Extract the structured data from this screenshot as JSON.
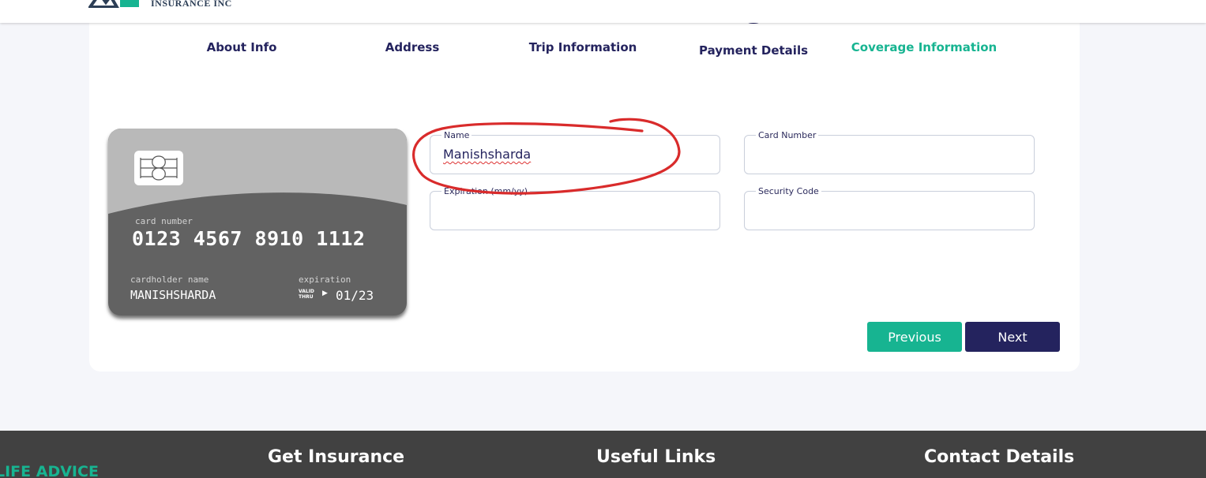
{
  "header": {
    "company_subtitle": "INSURANCE INC"
  },
  "stepper": {
    "steps": [
      {
        "label": "About Info"
      },
      {
        "label": "Address"
      },
      {
        "label": "Trip Information"
      },
      {
        "label": "Payment Details"
      },
      {
        "label": "Coverage Information"
      }
    ]
  },
  "card_preview": {
    "number_label": "card number",
    "number": "0123 4567 8910 1112",
    "holder_label": "cardholder name",
    "holder": "MANISHSHARDA",
    "expiration_label": "expiration",
    "valid_label_1": "VALID",
    "valid_label_2": "THRU",
    "expiration": "01/23"
  },
  "form": {
    "name": {
      "label": "Name",
      "value": "Manishsharda"
    },
    "card_number": {
      "label": "Card Number",
      "value": ""
    },
    "expiration": {
      "label": "Expiration (mm/yy)",
      "value": ""
    },
    "security_code": {
      "label": "Security Code",
      "value": ""
    }
  },
  "buttons": {
    "previous": "Previous",
    "next": "Next"
  },
  "footer": {
    "left_text": "LIFE ADVICE",
    "headings": [
      "Get Insurance",
      "Useful Links",
      "Contact Details"
    ]
  },
  "colors": {
    "navy": "#24235e",
    "green": "#17b491",
    "annotation_red": "#d92b2b",
    "footer_bg": "#414141"
  }
}
